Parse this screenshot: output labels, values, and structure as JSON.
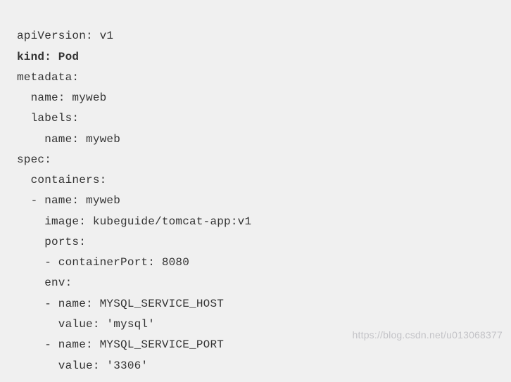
{
  "code": {
    "line1": "apiVersion: v1",
    "line2": "kind: Pod",
    "line3": "metadata:",
    "line4": "  name: myweb",
    "line5": "  labels:",
    "line6": "    name: myweb",
    "line7": "spec:",
    "line8": "  containers:",
    "line9": "  - name: myweb",
    "line10": "    image: kubeguide/tomcat-app:v1",
    "line11": "    ports:",
    "line12": "    - containerPort: 8080",
    "line13": "    env:",
    "line14": "    - name: MYSQL_SERVICE_HOST",
    "line15": "      value: 'mysql'",
    "line16": "    - name: MYSQL_SERVICE_PORT",
    "line17": "      value: '3306'"
  },
  "watermark": "https://blog.csdn.net/u013068377"
}
